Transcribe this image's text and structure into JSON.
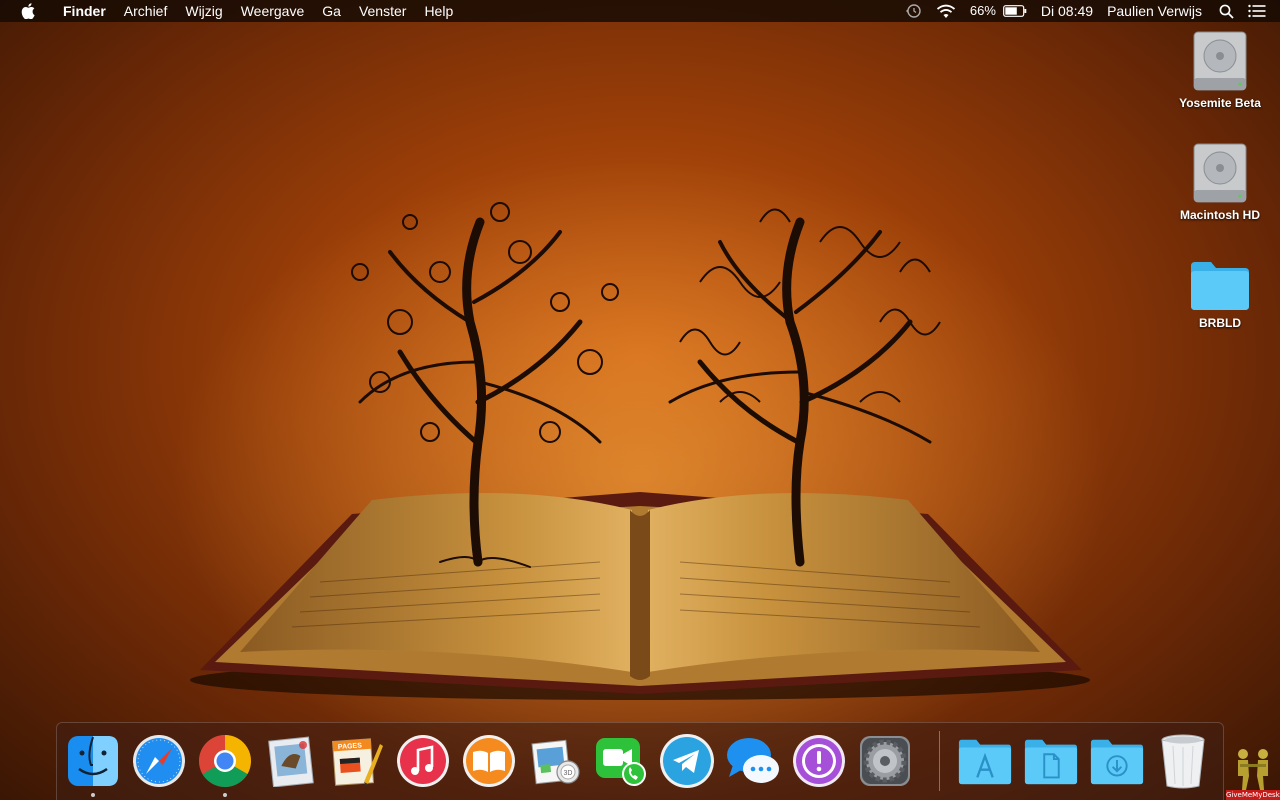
{
  "menubar": {
    "app_name": "Finder",
    "menus": [
      "Archief",
      "Wijzig",
      "Weergave",
      "Ga",
      "Venster",
      "Help"
    ],
    "battery": "66%",
    "clock": "Di 08:49",
    "user": "Paulien Verwijs"
  },
  "desktop": {
    "icons": [
      {
        "label": "Yosemite Beta",
        "icon": "hard-drive-icon"
      },
      {
        "label": "Macintosh HD",
        "icon": "hard-drive-icon"
      },
      {
        "label": "BRBLD",
        "icon": "folder-icon"
      }
    ]
  },
  "dock": {
    "apps": [
      {
        "name": "finder-icon",
        "running": true
      },
      {
        "name": "safari-icon",
        "running": false
      },
      {
        "name": "chrome-icon",
        "running": true
      },
      {
        "name": "mail-icon",
        "running": false
      },
      {
        "name": "pages-icon",
        "running": false
      },
      {
        "name": "itunes-icon",
        "running": false
      },
      {
        "name": "ibooks-icon",
        "running": false
      },
      {
        "name": "preview-icon",
        "running": false
      },
      {
        "name": "facetime-icon",
        "running": false
      },
      {
        "name": "telegram-icon",
        "running": false
      },
      {
        "name": "messages-icon",
        "running": false
      },
      {
        "name": "feedback-icon",
        "running": false
      },
      {
        "name": "system-preferences-icon",
        "running": false
      }
    ],
    "stacks": [
      "applications-folder-icon",
      "documents-folder-icon",
      "downloads-folder-icon",
      "trash-icon"
    ],
    "pages_badge": "PAGES"
  },
  "watermark": {
    "text": "GiveMeMyDesk.com"
  },
  "colors": {
    "menubar": "#140a04",
    "wallpaper_center": "#c85a10",
    "wallpaper_edge": "#3a1604",
    "folder_blue": "#4fc3f7"
  }
}
